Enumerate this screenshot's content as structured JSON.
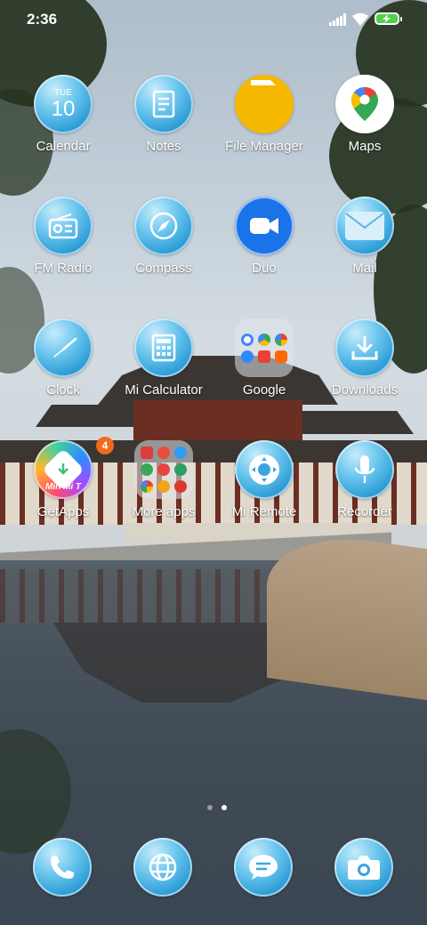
{
  "status_bar": {
    "time": "2:36"
  },
  "apps": {
    "calendar": {
      "label": "Calendar",
      "weekday": "TUE",
      "day": "10"
    },
    "notes": {
      "label": "Notes"
    },
    "file_manager": {
      "label": "File Manager"
    },
    "maps": {
      "label": "Maps"
    },
    "fm_radio": {
      "label": "FM Radio"
    },
    "compass": {
      "label": "Compass"
    },
    "duo": {
      "label": "Duo"
    },
    "mail": {
      "label": "Mail"
    },
    "clock": {
      "label": "Clock"
    },
    "calculator": {
      "label": "Mi Calculator"
    },
    "google_folder": {
      "label": "Google"
    },
    "downloads": {
      "label": "Downloads"
    },
    "getapps": {
      "label": "GetApps",
      "badge": "4",
      "icon_text": "Min Mi T"
    },
    "more_apps_folder": {
      "label": "More apps"
    },
    "mi_remote": {
      "label": "Mi Remote"
    },
    "recorder": {
      "label": "Recorder"
    }
  },
  "dock": [
    "phone",
    "browser",
    "messages",
    "camera"
  ],
  "colors": {
    "icon_blue": "#2a9bd5",
    "file_manager_yellow": "#f6b800",
    "duo_blue": "#1a73e8",
    "badge_orange": "#f26a1b"
  },
  "page_indicator": {
    "pages": 2,
    "current": 2
  }
}
